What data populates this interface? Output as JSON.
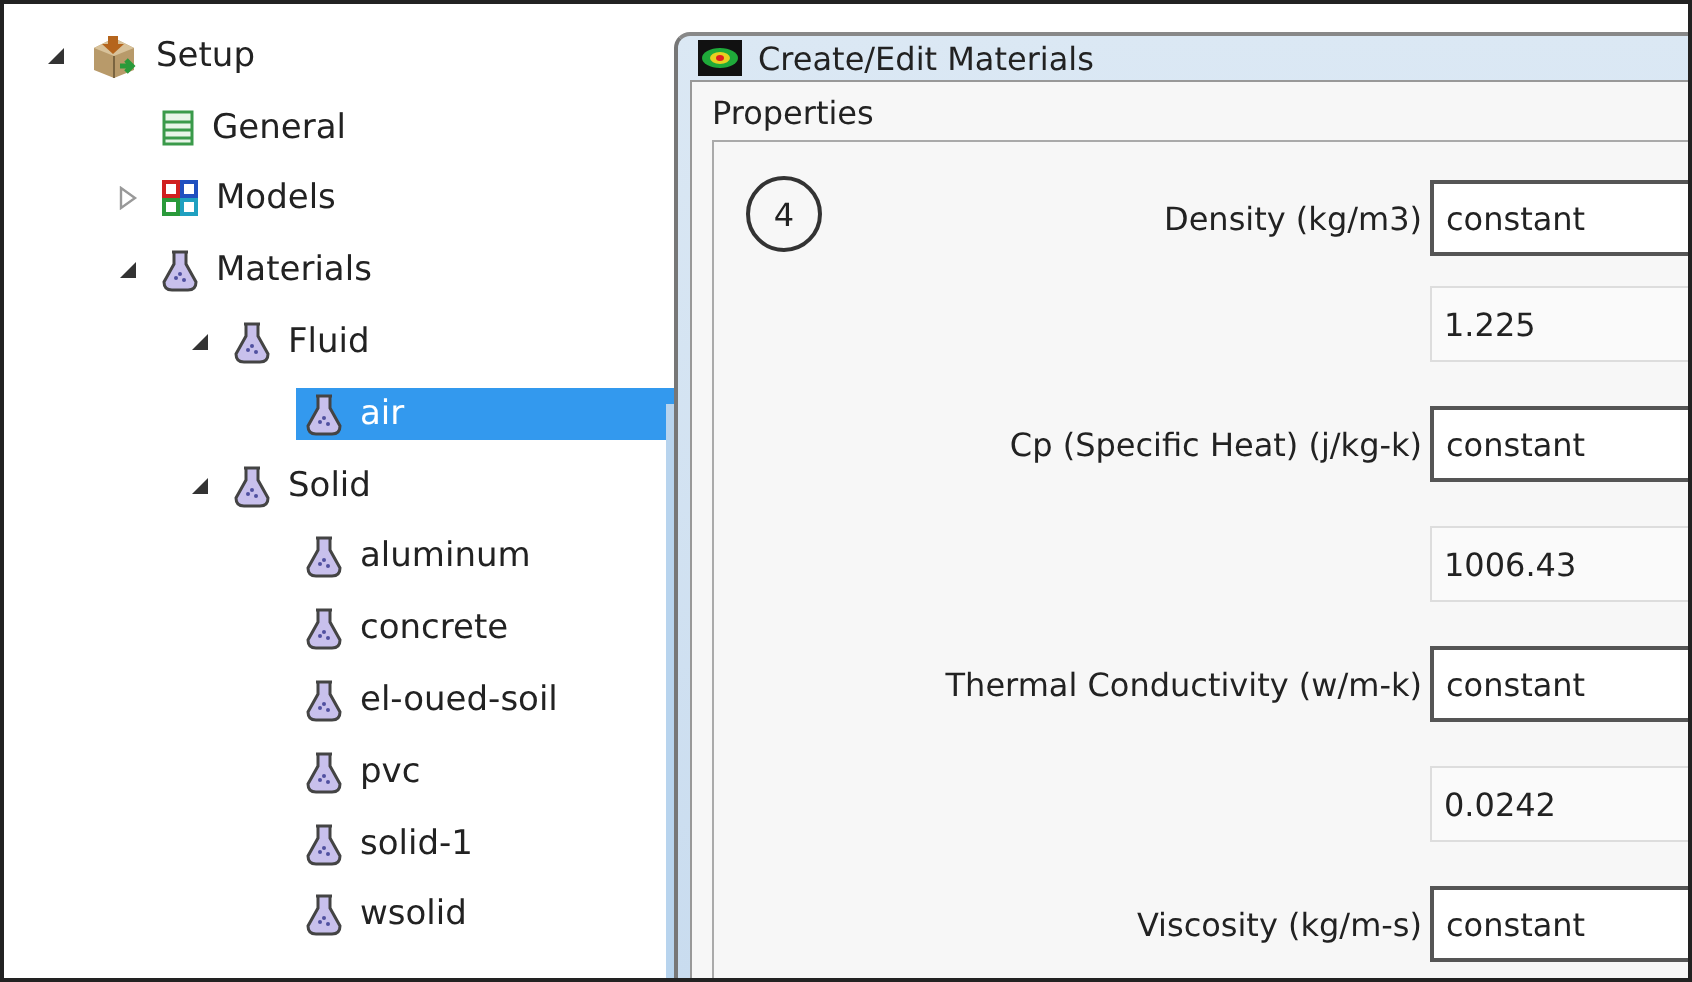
{
  "tree": [
    {
      "label": "Setup",
      "kind": "setup",
      "expanded": true,
      "selected": false,
      "children": [
        {
          "label": "General",
          "kind": "general",
          "selected": false
        },
        {
          "label": "Models",
          "kind": "models",
          "expanded": false,
          "selected": false
        },
        {
          "label": "Materials",
          "kind": "material",
          "expanded": true,
          "selected": false,
          "children": [
            {
              "label": "Fluid",
              "kind": "material",
              "expanded": true,
              "selected": false,
              "children": [
                {
                  "label": "air",
                  "kind": "material",
                  "selected": true
                }
              ]
            },
            {
              "label": "Solid",
              "kind": "material",
              "expanded": true,
              "selected": false,
              "children": [
                {
                  "label": "aluminum",
                  "kind": "material",
                  "selected": false
                },
                {
                  "label": "concrete",
                  "kind": "material",
                  "selected": false
                },
                {
                  "label": "el-oued-soil",
                  "kind": "material",
                  "selected": false
                },
                {
                  "label": "pvc",
                  "kind": "material",
                  "selected": false
                },
                {
                  "label": "solid-1",
                  "kind": "material",
                  "selected": false
                },
                {
                  "label": "wsolid",
                  "kind": "material",
                  "selected": false
                }
              ]
            }
          ]
        }
      ]
    }
  ],
  "dialog": {
    "title": "Create/Edit Materials",
    "group_label": "Properties",
    "annotation": "4",
    "properties": [
      {
        "label": "Density (kg/m3)",
        "method": "constant",
        "value": "1.225"
      },
      {
        "label": "Cp (Specific Heat) (j/kg-k)",
        "method": "constant",
        "value": "1006.43"
      },
      {
        "label": "Thermal Conductivity (w/m-k)",
        "method": "constant",
        "value": "0.0242"
      },
      {
        "label": "Viscosity (kg/m-s)",
        "method": "constant"
      }
    ]
  }
}
